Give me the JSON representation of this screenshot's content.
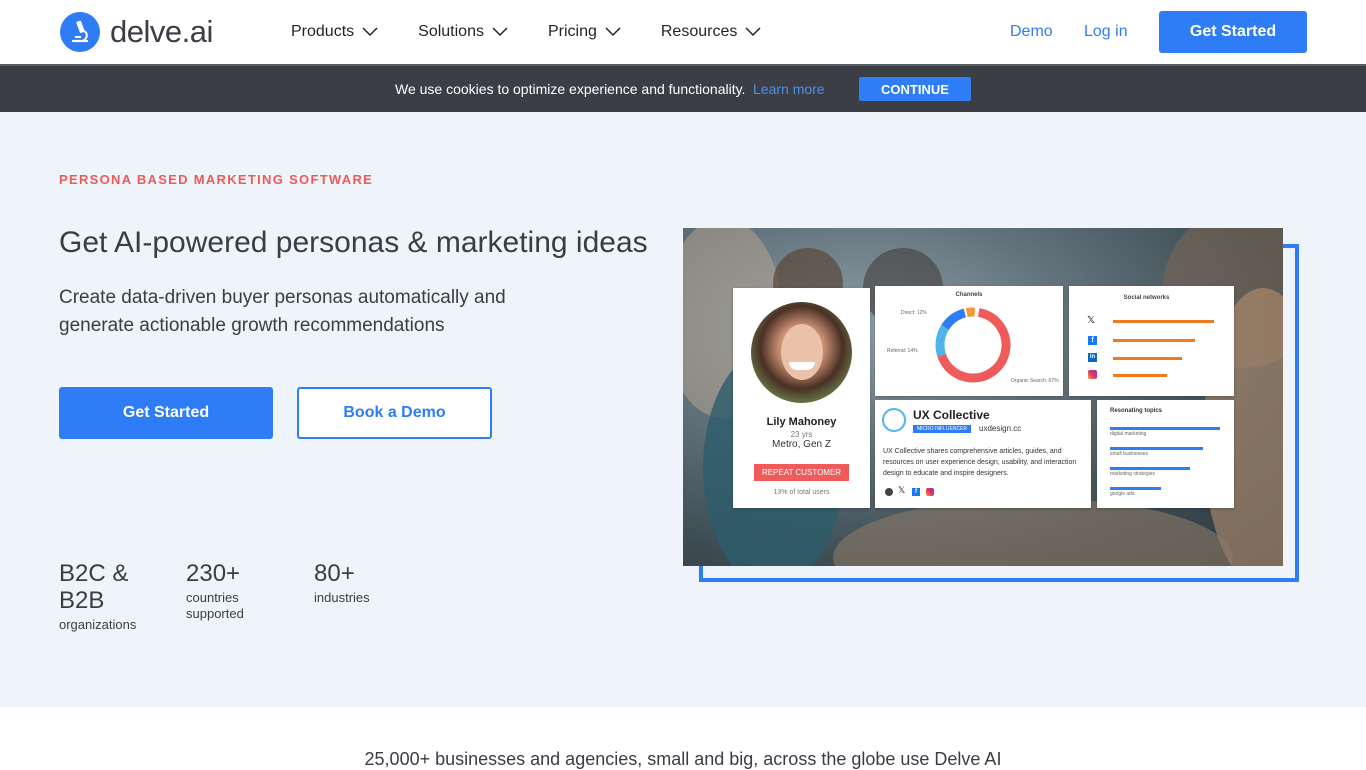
{
  "brand": {
    "name": "delve.ai",
    "accent": "#2e7cf6"
  },
  "nav": {
    "items": [
      {
        "label": "Products"
      },
      {
        "label": "Solutions"
      },
      {
        "label": "Pricing"
      },
      {
        "label": "Resources"
      }
    ],
    "demo": "Demo",
    "login": "Log in",
    "cta": "Get Started"
  },
  "cookie": {
    "text": "We use cookies to optimize experience and functionality.",
    "link": "Learn more",
    "button": "CONTINUE"
  },
  "hero": {
    "eyebrow": "PERSONA BASED MARKETING SOFTWARE",
    "title": "Get AI-powered personas & marketing ideas",
    "subtitle": "Create data-driven buyer personas automatically and generate actionable growth recommendations",
    "primary_cta": "Get Started",
    "secondary_cta": "Book a Demo",
    "stats": [
      {
        "value": "B2C & B2B",
        "label": "organizations"
      },
      {
        "value": "230+",
        "label": "countries supported"
      },
      {
        "value": "80+",
        "label": "industries"
      }
    ]
  },
  "persona": {
    "name": "Lily Mahoney",
    "age": "23 yrs",
    "segment": "Metro, Gen Z",
    "badge": "REPEAT CUSTOMER",
    "share": "13% of total users"
  },
  "channels": {
    "title": "Channels",
    "direct": "Direct: 12%",
    "referral": "Referral: 14%",
    "organic": "Organic Search: 67%"
  },
  "social": {
    "title": "Social networks"
  },
  "influencer": {
    "name": "UX Collective",
    "tag": "MICRO INFLUENCER",
    "site": "uxdesign.cc",
    "desc": "UX Collective shares comprehensive articles, guides, and resources on user experience design, usability, and interaction design to educate and inspire designers."
  },
  "topics": {
    "title": "Resonating topics",
    "items": [
      "digital marketing",
      "small businesses",
      "marketing strategies",
      "google ads"
    ]
  },
  "trust": {
    "text": "25,000+ businesses and agencies, small and big, across the globe use Delve AI"
  }
}
